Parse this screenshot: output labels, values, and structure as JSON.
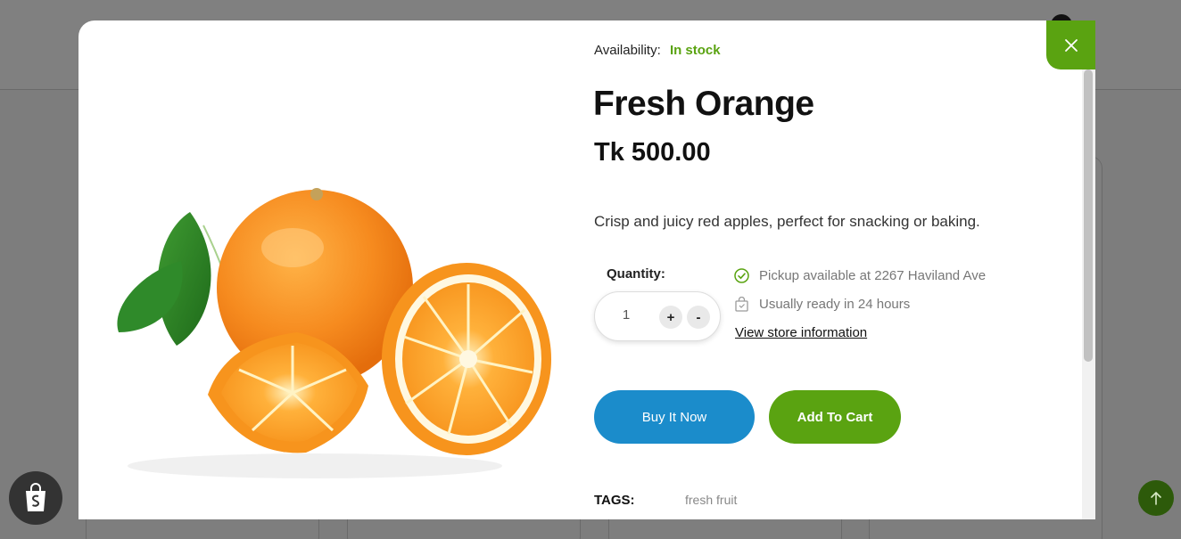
{
  "product": {
    "availability_label": "Availability:",
    "availability_value": "In stock",
    "title": "Fresh Orange",
    "price": "Tk 500.00",
    "description": "Crisp and juicy red apples, perfect for snacking or baking.",
    "image_icon": "orange-fruit-image"
  },
  "quantity": {
    "label": "Quantity:",
    "value": "1",
    "increment_label": "+",
    "decrement_label": "-"
  },
  "pickup": {
    "available_text": "Pickup available at 2267 Haviland Ave",
    "ready_text": "Usually ready in 24 hours",
    "store_link": "View store information"
  },
  "actions": {
    "buy_now": "Buy It Now",
    "add_to_cart": "Add To Cart"
  },
  "tags": {
    "label": "TAGS:",
    "items": [
      "fresh fruit"
    ]
  },
  "colors": {
    "accent_green": "#5aa311",
    "buy_blue": "#1b8ccb",
    "scroll_top_green": "#2d5a0a"
  }
}
